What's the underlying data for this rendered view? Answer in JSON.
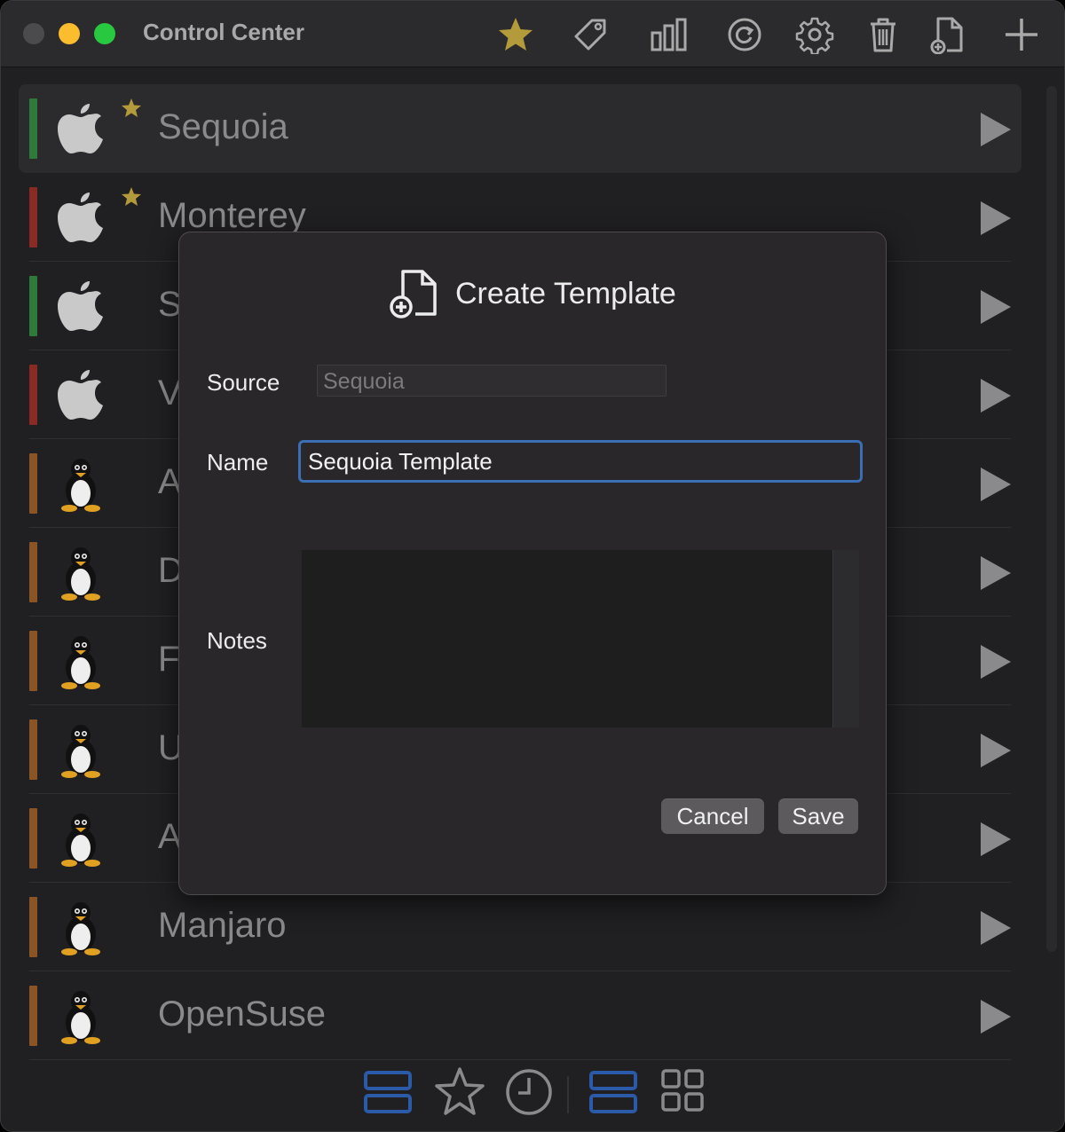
{
  "window": {
    "title": "Control Center"
  },
  "toolbar": {
    "icons": [
      "star-icon",
      "tag-icon",
      "bar-chart-icon",
      "refresh-icon",
      "gear-icon",
      "trash-icon",
      "create-template-icon",
      "plus-icon"
    ]
  },
  "vms": [
    {
      "name": "Sequoia",
      "os": "apple",
      "status_color": "#2f7a3a",
      "favorite": true,
      "selected": true
    },
    {
      "name": "Monterey",
      "os": "apple",
      "status_color": "#8a2a24",
      "favorite": true
    },
    {
      "name": "S",
      "os": "apple",
      "status_color": "#2f7a3a"
    },
    {
      "name": "V",
      "os": "apple",
      "status_color": "#8a2a24"
    },
    {
      "name": "A",
      "os": "linux",
      "status_color": "#8a5424"
    },
    {
      "name": "D",
      "os": "linux",
      "status_color": "#8a5424"
    },
    {
      "name": "F",
      "os": "linux",
      "status_color": "#8a5424"
    },
    {
      "name": "U",
      "os": "linux",
      "status_color": "#8a5424"
    },
    {
      "name": "A",
      "os": "linux",
      "status_color": "#8a5424"
    },
    {
      "name": "Manjaro",
      "os": "linux",
      "status_color": "#8a5424"
    },
    {
      "name": "OpenSuse",
      "os": "linux",
      "status_color": "#8a5424"
    }
  ],
  "bottom_bar": {
    "icons": [
      "list-view-icon",
      "favorites-icon",
      "recent-icon",
      "detail-view-icon",
      "grid-view-icon"
    ],
    "active_color": "#2a5aa8"
  },
  "dialog": {
    "title": "Create Template",
    "source_label": "Source",
    "source_value": "Sequoia",
    "name_label": "Name",
    "name_value": "Sequoia Template",
    "notes_label": "Notes",
    "notes_value": "",
    "cancel_label": "Cancel",
    "save_label": "Save"
  },
  "colors": {
    "accent": "#3a6fb5",
    "favorite": "#b39a3a"
  }
}
